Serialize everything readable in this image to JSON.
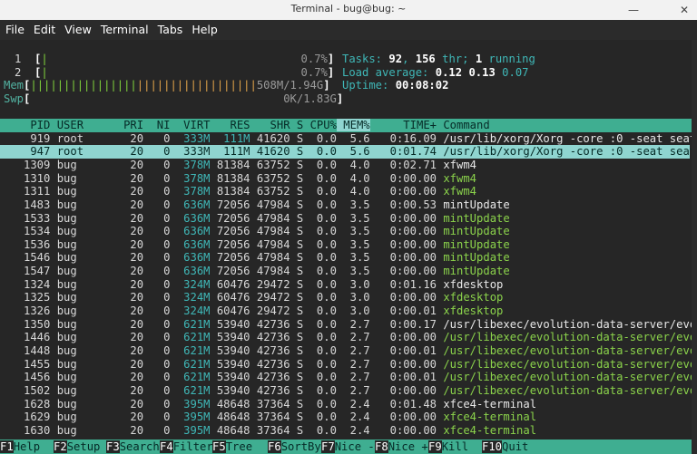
{
  "window": {
    "title": "Terminal - bug@bug: ~"
  },
  "menu": [
    "File",
    "Edit",
    "View",
    "Terminal",
    "Tabs",
    "Help"
  ],
  "meters": {
    "cpu1": {
      "label": "1",
      "value": "0.7%"
    },
    "cpu2": {
      "label": "2",
      "value": "0.7%"
    },
    "mem": {
      "label": "Mem",
      "value": "508M/1.94G"
    },
    "swp": {
      "label": "Swp",
      "value": "0K/1.83G"
    }
  },
  "summary": {
    "tasks_label": "Tasks:",
    "tasks": "92",
    "thr": "156",
    "thr_label": "thr;",
    "running": "1",
    "running_label": "running",
    "load_label": "Load average:",
    "load1": "0.12",
    "load5": "0.13",
    "load15": "0.07",
    "uptime_label": "Uptime:",
    "uptime": "00:08:02"
  },
  "columns": [
    "PID",
    "USER",
    "PRI",
    "NI",
    "VIRT",
    "RES",
    "SHR",
    "S",
    "CPU%",
    "MEM%",
    "TIME+",
    "Command"
  ],
  "processes": [
    {
      "pid": "919",
      "user": "root",
      "pri": "20",
      "ni": "0",
      "virt": "333M",
      "res": "111M",
      "shr": "41620",
      "s": "S",
      "cpu": "0.0",
      "mem": "5.6",
      "time": "0:16.09",
      "cmd": "/usr/lib/xorg/Xorg -core :0 -seat seat"
    },
    {
      "pid": "947",
      "user": "root",
      "pri": "20",
      "ni": "0",
      "virt": "333M",
      "res": "111M",
      "shr": "41620",
      "s": "S",
      "cpu": "0.0",
      "mem": "5.6",
      "time": "0:01.74",
      "cmd": "/usr/lib/xorg/Xorg -core :0 -seat seat"
    },
    {
      "pid": "1309",
      "user": "bug",
      "pri": "20",
      "ni": "0",
      "virt": "378M",
      "res": "81384",
      "shr": "63752",
      "s": "S",
      "cpu": "0.0",
      "mem": "4.0",
      "time": "0:02.71",
      "cmd": "xfwm4"
    },
    {
      "pid": "1310",
      "user": "bug",
      "pri": "20",
      "ni": "0",
      "virt": "378M",
      "res": "81384",
      "shr": "63752",
      "s": "S",
      "cpu": "0.0",
      "mem": "4.0",
      "time": "0:00.00",
      "cmd": "xfwm4"
    },
    {
      "pid": "1311",
      "user": "bug",
      "pri": "20",
      "ni": "0",
      "virt": "378M",
      "res": "81384",
      "shr": "63752",
      "s": "S",
      "cpu": "0.0",
      "mem": "4.0",
      "time": "0:00.00",
      "cmd": "xfwm4"
    },
    {
      "pid": "1483",
      "user": "bug",
      "pri": "20",
      "ni": "0",
      "virt": "636M",
      "res": "72056",
      "shr": "47984",
      "s": "S",
      "cpu": "0.0",
      "mem": "3.5",
      "time": "0:00.53",
      "cmd": "mintUpdate"
    },
    {
      "pid": "1533",
      "user": "bug",
      "pri": "20",
      "ni": "0",
      "virt": "636M",
      "res": "72056",
      "shr": "47984",
      "s": "S",
      "cpu": "0.0",
      "mem": "3.5",
      "time": "0:00.00",
      "cmd": "mintUpdate"
    },
    {
      "pid": "1534",
      "user": "bug",
      "pri": "20",
      "ni": "0",
      "virt": "636M",
      "res": "72056",
      "shr": "47984",
      "s": "S",
      "cpu": "0.0",
      "mem": "3.5",
      "time": "0:00.00",
      "cmd": "mintUpdate"
    },
    {
      "pid": "1536",
      "user": "bug",
      "pri": "20",
      "ni": "0",
      "virt": "636M",
      "res": "72056",
      "shr": "47984",
      "s": "S",
      "cpu": "0.0",
      "mem": "3.5",
      "time": "0:00.00",
      "cmd": "mintUpdate"
    },
    {
      "pid": "1546",
      "user": "bug",
      "pri": "20",
      "ni": "0",
      "virt": "636M",
      "res": "72056",
      "shr": "47984",
      "s": "S",
      "cpu": "0.0",
      "mem": "3.5",
      "time": "0:00.00",
      "cmd": "mintUpdate"
    },
    {
      "pid": "1547",
      "user": "bug",
      "pri": "20",
      "ni": "0",
      "virt": "636M",
      "res": "72056",
      "shr": "47984",
      "s": "S",
      "cpu": "0.0",
      "mem": "3.5",
      "time": "0:00.00",
      "cmd": "mintUpdate"
    },
    {
      "pid": "1324",
      "user": "bug",
      "pri": "20",
      "ni": "0",
      "virt": "324M",
      "res": "60476",
      "shr": "29472",
      "s": "S",
      "cpu": "0.0",
      "mem": "3.0",
      "time": "0:01.16",
      "cmd": "xfdesktop"
    },
    {
      "pid": "1325",
      "user": "bug",
      "pri": "20",
      "ni": "0",
      "virt": "324M",
      "res": "60476",
      "shr": "29472",
      "s": "S",
      "cpu": "0.0",
      "mem": "3.0",
      "time": "0:00.00",
      "cmd": "xfdesktop"
    },
    {
      "pid": "1326",
      "user": "bug",
      "pri": "20",
      "ni": "0",
      "virt": "324M",
      "res": "60476",
      "shr": "29472",
      "s": "S",
      "cpu": "0.0",
      "mem": "3.0",
      "time": "0:00.01",
      "cmd": "xfdesktop"
    },
    {
      "pid": "1350",
      "user": "bug",
      "pri": "20",
      "ni": "0",
      "virt": "621M",
      "res": "53940",
      "shr": "42736",
      "s": "S",
      "cpu": "0.0",
      "mem": "2.7",
      "time": "0:00.17",
      "cmd": "/usr/libexec/evolution-data-server/evo"
    },
    {
      "pid": "1446",
      "user": "bug",
      "pri": "20",
      "ni": "0",
      "virt": "621M",
      "res": "53940",
      "shr": "42736",
      "s": "S",
      "cpu": "0.0",
      "mem": "2.7",
      "time": "0:00.00",
      "cmd": "/usr/libexec/evolution-data-server/evo"
    },
    {
      "pid": "1448",
      "user": "bug",
      "pri": "20",
      "ni": "0",
      "virt": "621M",
      "res": "53940",
      "shr": "42736",
      "s": "S",
      "cpu": "0.0",
      "mem": "2.7",
      "time": "0:00.01",
      "cmd": "/usr/libexec/evolution-data-server/evo"
    },
    {
      "pid": "1455",
      "user": "bug",
      "pri": "20",
      "ni": "0",
      "virt": "621M",
      "res": "53940",
      "shr": "42736",
      "s": "S",
      "cpu": "0.0",
      "mem": "2.7",
      "time": "0:00.00",
      "cmd": "/usr/libexec/evolution-data-server/evo"
    },
    {
      "pid": "1456",
      "user": "bug",
      "pri": "20",
      "ni": "0",
      "virt": "621M",
      "res": "53940",
      "shr": "42736",
      "s": "S",
      "cpu": "0.0",
      "mem": "2.7",
      "time": "0:00.01",
      "cmd": "/usr/libexec/evolution-data-server/evo"
    },
    {
      "pid": "1502",
      "user": "bug",
      "pri": "20",
      "ni": "0",
      "virt": "621M",
      "res": "53940",
      "shr": "42736",
      "s": "S",
      "cpu": "0.0",
      "mem": "2.7",
      "time": "0:00.00",
      "cmd": "/usr/libexec/evolution-data-server/evo"
    },
    {
      "pid": "1628",
      "user": "bug",
      "pri": "20",
      "ni": "0",
      "virt": "395M",
      "res": "48648",
      "shr": "37364",
      "s": "S",
      "cpu": "0.0",
      "mem": "2.4",
      "time": "0:01.48",
      "cmd": "xfce4-terminal"
    },
    {
      "pid": "1629",
      "user": "bug",
      "pri": "20",
      "ni": "0",
      "virt": "395M",
      "res": "48648",
      "shr": "37364",
      "s": "S",
      "cpu": "0.0",
      "mem": "2.4",
      "time": "0:00.00",
      "cmd": "xfce4-terminal"
    },
    {
      "pid": "1630",
      "user": "bug",
      "pri": "20",
      "ni": "0",
      "virt": "395M",
      "res": "48648",
      "shr": "37364",
      "s": "S",
      "cpu": "0.0",
      "mem": "2.4",
      "time": "0:00.00",
      "cmd": "xfce4-terminal"
    }
  ],
  "footer": [
    {
      "key": "F1",
      "label": "Help"
    },
    {
      "key": "F2",
      "label": "Setup"
    },
    {
      "key": "F3",
      "label": "Search"
    },
    {
      "key": "F4",
      "label": "Filter"
    },
    {
      "key": "F5",
      "label": "Tree"
    },
    {
      "key": "F6",
      "label": "SortBy"
    },
    {
      "key": "F7",
      "label": "Nice -"
    },
    {
      "key": "F8",
      "label": "Nice +"
    },
    {
      "key": "F9",
      "label": "Kill"
    },
    {
      "key": "F10",
      "label": "Quit"
    }
  ],
  "colors": {
    "header_bg": "#3fae91",
    "selected_bg": "#8fd5d0",
    "bar_green": "#7fd13b",
    "bar_orange": "#e0a34a",
    "cyan": "#3fb7b7"
  },
  "thread_rows": [
    1,
    3,
    4,
    6,
    7,
    8,
    9,
    10,
    12,
    13,
    15,
    16,
    17,
    18,
    19,
    21,
    22
  ]
}
